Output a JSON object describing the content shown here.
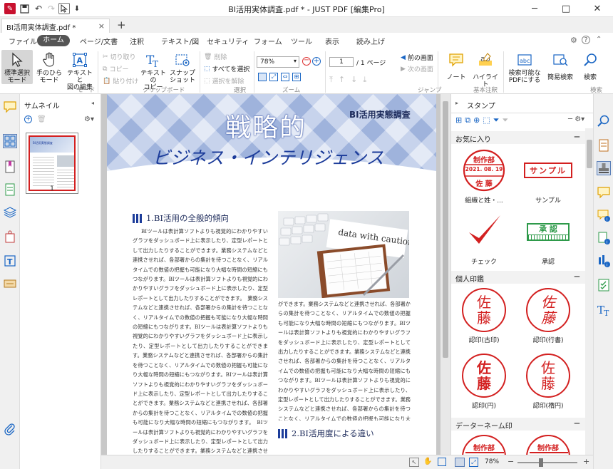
{
  "window": {
    "title": "BI活用実体調査.pdf * - JUST PDF [編集Pro]",
    "minimize": "─",
    "maximize": "□",
    "close": "✕"
  },
  "tab": {
    "label": "BI活用実体調査.pdf *",
    "close": "×",
    "new": "+"
  },
  "menu": {
    "items": [
      "ファイル",
      "ホーム",
      "ページ/文書",
      "注釈",
      "テキスト/図",
      "セキュリティ",
      "フォーム",
      "ツール",
      "表示",
      "読み上げ"
    ]
  },
  "ribbon": {
    "mode": {
      "standard": [
        "標準選択",
        "モード"
      ],
      "hand": [
        "手のひら",
        "モード"
      ],
      "textedit": [
        "テキストと",
        "図の編集"
      ],
      "group": "モード"
    },
    "clipboard": {
      "cut": "切り取り",
      "copy": "コピー",
      "paste": "貼り付け",
      "text_copy": [
        "テキストの",
        "コピー"
      ],
      "snapshot": [
        "スナップ",
        "ショット"
      ],
      "group": "クリップボード"
    },
    "select": {
      "delete": "削除",
      "select_all": "すべてを選択",
      "deselect": "選択を解除",
      "group": "選択"
    },
    "zoom": {
      "value": "78%",
      "group": "ズーム"
    },
    "jump": {
      "page": "1",
      "total": "/ 1 ページ",
      "prev": "前の画面",
      "next": "次の画面",
      "group": "ジャンプ"
    },
    "basic_note": {
      "note": "ノート",
      "highlight": "ハイライト",
      "group": "基本注釈"
    },
    "search": {
      "searchable": [
        "検索可能な",
        "PDFにする"
      ],
      "simple": "簡易検索",
      "search": "検索",
      "group": "検索"
    }
  },
  "thumbnail": {
    "title": "サムネイル",
    "page_no": "1",
    "thumb_title": "BI活用実態調査"
  },
  "page": {
    "header_tag": "BI活用実態調査",
    "title1": "戦略的",
    "title2": "ビジネス・インテリジェンス",
    "h1": "1.BI活用の全般的傾向",
    "h2": "2.BI活用度による違い",
    "photo_caption": "data with caution",
    "col1": "BIツールは表計算ソフトよりも視覚的にわかりやすいグラフをダッシュボード上に表示したり、定型レポートとして出力したりすることができます。業務システムなどと連携させれば、各部署からの集計を待つことなく、リアルタイムでの数値の把握も可能になり大幅な時間の短縮にもつながります。BIツールは表計算ソフトよりも視覚的にわかりやすいグラフをダッシュボード上に表示したり、定型レポートとして出力したりすることができます。　業務システムなどと連携させれば、各部署からの集計を待つことなく、リアルタイムでの数値の把握も可能になり大幅な時間の短縮にもつながります。BIツールは表計算ソフトよりも視覚的にわかりやすいグラフをダッシュボード上に表示したり、定型レポートとして出力したりすることができます。業務システムなどと連携させれば、各部署からの集計を待つことなく、リアルタイムでの数値の把握も可能になり大幅な時間の短縮にもつながります。BIツールは表計算ソフトよりも視覚的にわかりやすいグラフをダッシュボード上に表示したり、定型レポートとして出力したりすることができます。業務システムなどと連携させれば、各部署からの集計を待つことなく、リアルタイムでの数値の把握も可能になり大幅な時間の短縮にもつながります。　BIツールは表計算ソフトよりも視覚的にわかりやすいグラフをダッシュボード上に表示したり、定型レポートとして出力したりすることができます。業務システムなどと連携させれば、各部署からの集計を待つことなく、リアルタイム",
    "col2": "ができます。業務システムなどと連携させれば、各部署からの集計を待つことなく、リアルタイムでの数値の把握も可能になり大幅な時間の短縮にもつながります。BIツールは表計算ソフトよりも視覚的にわかりやすいグラフをダッシュボード上に表示したり、定型レポートとして出力したりすることができます。業務システムなどと連携させれば、各部署からの集計を待つことなく、リアルタイムでの数値の把握も可能になり大幅な時間の短縮にもつながります。BIツールは表計算ソフトよりも視覚的にわかりやすいグラフをダッシュボード上に表示したり、定型レポートとして出力したりすることができます。業務システムなどと連携させれば、各部署からの集計を待つことなく、リアルタイムでの数値の把握も可能になり大幅な時間の短縮にもつながります。"
  },
  "stamps": {
    "title": "スタンプ",
    "favorites": "お気に入り",
    "personal": "個人印鑑",
    "datename": "データーネーム印",
    "items": {
      "org": {
        "top": "制作部",
        "date": "2021. 08. 19",
        "name": "佐 藤",
        "label": "組織と姓・..."
      },
      "sample": {
        "text": "サンプル",
        "label": "サンプル"
      },
      "check": {
        "label": "チェック"
      },
      "approve": {
        "text": "承 認",
        "label": "承認"
      },
      "kichi": {
        "char1": "佐",
        "char2": "藤",
        "label": "認印(古印)"
      },
      "gyo": {
        "char1": "佐",
        "char2": "藤",
        "label": "認印(行書)"
      },
      "en": {
        "char1": "佐",
        "char2": "藤",
        "label": "認印(円)"
      },
      "kaku": {
        "char1": "佐",
        "char2": "藤",
        "label": "認印(楕円)"
      },
      "dn1": {
        "top": "制作部"
      },
      "dn2": {
        "top": "制作部"
      }
    }
  },
  "status": {
    "zoom": "78%"
  },
  "colors": {
    "accent": "#1a66c4",
    "stamp_red": "#d32020",
    "approve_green": "#2e9a4a",
    "title_blue": "#1c3c9a"
  }
}
